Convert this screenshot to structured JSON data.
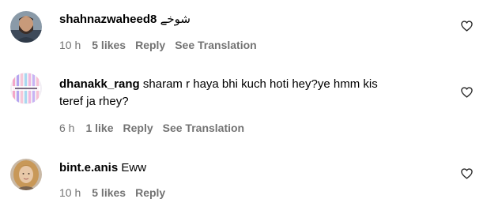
{
  "colors": {
    "text": "#000000",
    "meta": "#737373",
    "background": "#ffffff"
  },
  "comments": [
    {
      "username": "shahnazwaheed8",
      "text": "شوخے",
      "time": "10 h",
      "likes": "5 likes",
      "reply": "Reply",
      "translate": "See Translation",
      "avatar_icon": "profile-photo-man",
      "like_icon": "heart-outline-icon"
    },
    {
      "username": "dhanakk_rang",
      "text": "sharam r haya bhi kuch hoti hey?ye hmm kis",
      "text_line2": "teref ja rhey?",
      "time": "6 h",
      "likes": "1 like",
      "reply": "Reply",
      "translate": "See Translation",
      "avatar_icon": "rainbow-logo-avatar",
      "like_icon": "heart-outline-icon"
    },
    {
      "username": "bint.e.anis",
      "text": "Eww",
      "time": "10 h",
      "likes": "5 likes",
      "reply": "Reply",
      "avatar_icon": "profile-photo-woman",
      "like_icon": "heart-outline-icon"
    }
  ]
}
